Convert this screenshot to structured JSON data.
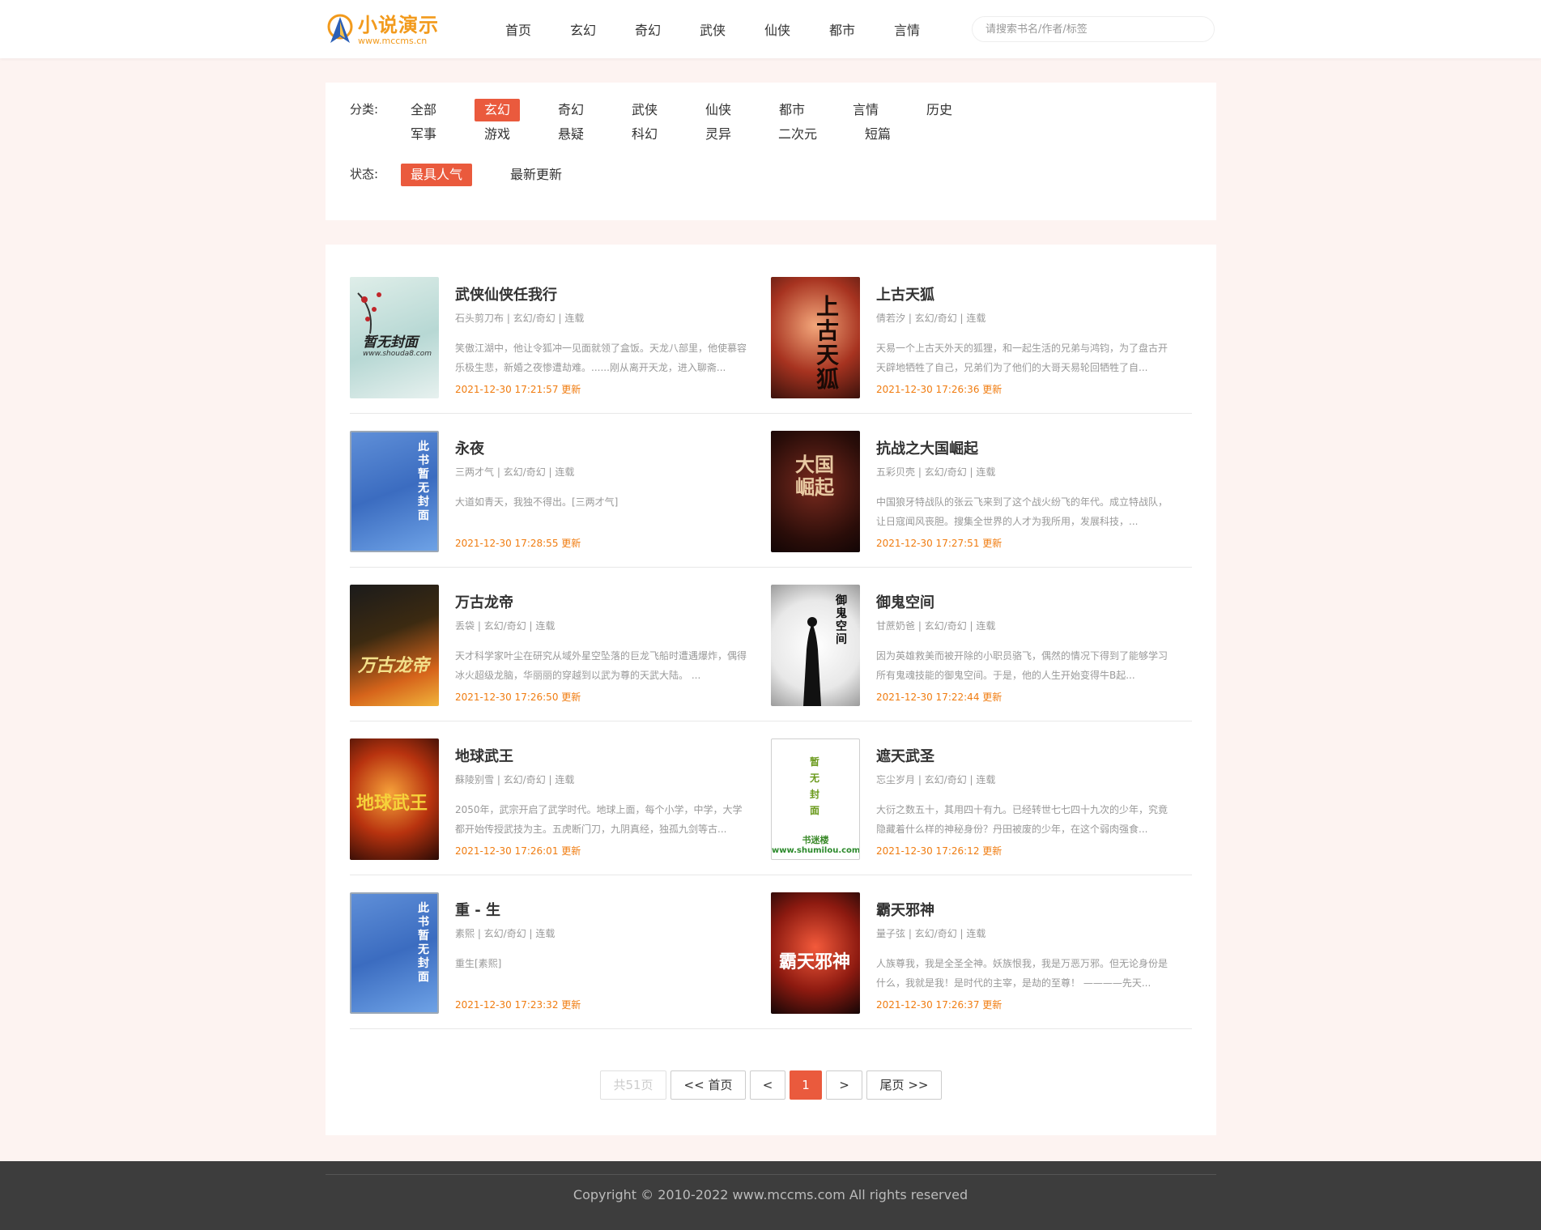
{
  "header": {
    "logo_title": "小说演示",
    "logo_url": "www.mccms.cn",
    "nav": [
      "首页",
      "玄幻",
      "奇幻",
      "武侠",
      "仙侠",
      "都市",
      "言情"
    ],
    "search_placeholder": "请搜索书名/作者/标签"
  },
  "filter": {
    "category_label": "分类:",
    "categories": [
      "全部",
      "玄幻",
      "奇幻",
      "武侠",
      "仙侠",
      "都市",
      "言情",
      "历史",
      "军事",
      "游戏",
      "悬疑",
      "科幻",
      "灵异",
      "二次元",
      "短篇"
    ],
    "active_category": "玄幻",
    "status_label": "状态:",
    "statuses": [
      "最具人气",
      "最新更新"
    ],
    "active_status": "最具人气"
  },
  "books": [
    {
      "title": "武侠仙侠任我行",
      "meta": "石头剪刀布 | 玄幻/奇幻 | 连载",
      "desc": "笑傲江湖中，他让令狐冲一见面就领了盒饭。天龙八部里，他使慕容乐极生悲，新婚之夜惨遭劫难。......刚从离开天龙，进入聊斋...",
      "date": "2021-12-30 17:21:57",
      "update": "更新",
      "cover_text": "暂无封面",
      "cover_sub": "www.shouda8.com"
    },
    {
      "title": "上古天狐",
      "meta": "倩若汐 | 玄幻/奇幻 | 连载",
      "desc": "天易一个上古天外天的狐狸，和一起生活的兄弟与鸿钧，为了盘古开天辟地牺牲了自己，兄弟们为了他们的大哥天易轮回牺牲了自...",
      "date": "2021-12-30 17:26:36",
      "update": "更新",
      "cover_text": "上古天狐"
    },
    {
      "title": "永夜",
      "meta": "三两才气 | 玄幻/奇幻 | 连载",
      "desc": "大道如青天，我独不得出。[三两才气]",
      "date": "2021-12-30 17:28:55",
      "update": "更新",
      "cover_text": "此书暂无封面"
    },
    {
      "title": "抗战之大国崛起",
      "meta": "五彩贝壳 | 玄幻/奇幻 | 连载",
      "desc": "中国狼牙特战队的张云飞来到了这个战火纷飞的年代。成立特战队，让日寇闻风丧胆。搜集全世界的人才为我所用，发展科技，...",
      "date": "2021-12-30 17:27:51",
      "update": "更新",
      "cover_text": "大国崛起"
    },
    {
      "title": "万古龙帝",
      "meta": "丢袋 | 玄幻/奇幻 | 连载",
      "desc": "天才科学家叶尘在研究从域外星空坠落的巨龙飞船时遭遇爆炸，偶得冰火超级龙脑，华丽丽的穿越到以武为尊的天武大陆。      ...",
      "date": "2021-12-30 17:26:50",
      "update": "更新",
      "cover_text": "万古龙帝"
    },
    {
      "title": "御鬼空间",
      "meta": "甘蔗奶爸 | 玄幻/奇幻 | 连载",
      "desc": "因为英雄救美而被开除的小职员骆飞，偶然的情况下得到了能够学习所有鬼魂技能的御鬼空间。于是，他的人生开始变得牛B起...",
      "date": "2021-12-30 17:22:44",
      "update": "更新",
      "cover_text": "御鬼空间"
    },
    {
      "title": "地球武王",
      "meta": "蘇陵别雪 | 玄幻/奇幻 | 连载",
      "desc": "2050年，武宗开启了武学时代。地球上面，每个小学，中学，大学都开始传授武技为主。五虎断门刀，九阴真经，独孤九剑等古...",
      "date": "2021-12-30 17:26:01",
      "update": "更新",
      "cover_text": "地球武王"
    },
    {
      "title": "遮天武圣",
      "meta": "忘尘岁月 | 玄幻/奇幻 | 连载",
      "desc": "大衍之数五十，其用四十有九。已经转世七七四十九次的少年，究竟隐藏着什么样的神秘身份？丹田被废的少年，在这个弱肉强食...",
      "date": "2021-12-30 17:26:12",
      "update": "更新",
      "cover_text": "暂无封面",
      "cover_sub1": "书迷楼",
      "cover_sub2": "www.shumilou.com"
    },
    {
      "title": "重 - 生",
      "meta": "素熙 | 玄幻/奇幻 | 连载",
      "desc": "重生[素熙]",
      "date": "2021-12-30 17:23:32",
      "update": "更新",
      "cover_text": "此书暂无封面"
    },
    {
      "title": "霸天邪神",
      "meta": "量子弦 | 玄幻/奇幻 | 连载",
      "desc": "人族尊我，我是全圣全神。妖族恨我，我是万恶万邪。但无论身份是什么，我就是我！是时代的主宰，是劫的至尊！ ————先天...",
      "date": "2021-12-30 17:26:37",
      "update": "更新",
      "cover_text": "霸天邪神"
    }
  ],
  "pagination": {
    "total": "共51页",
    "first": "<< 首页",
    "prev": "<",
    "current": "1",
    "next": ">",
    "last": "尾页 >>"
  },
  "footer": {
    "copyright": "Copyright © 2010-2022 www.mccms.com All rights reserved"
  },
  "colors": {
    "accent": "#ea5a3d",
    "date": "#f07c10",
    "logo": "#f29a1c",
    "footer_bg": "#3d3d3d"
  }
}
